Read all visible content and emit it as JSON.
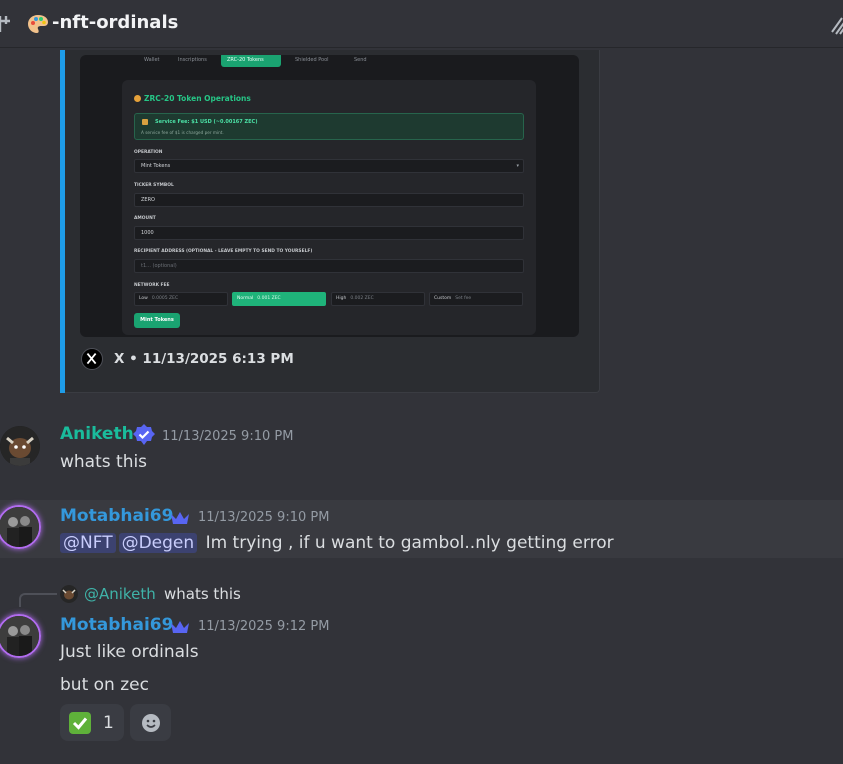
{
  "channel": {
    "emoji": "palette-icon",
    "name": "-nft-ordinals"
  },
  "embed": {
    "image": {
      "tabs": [
        "Wallet",
        "Inscriptions",
        "ZRC-20 Tokens",
        "Shielded Pool",
        "Send"
      ],
      "title": "ZRC-20 Token Operations",
      "fee_notice_title": "Service Fee: $1 USD (~0.00167 ZEC)",
      "fee_notice_sub": "A service fee of $1 is charged per mint.",
      "operation_label": "OPERATION",
      "operation_value": "Mint Tokens",
      "ticker_label": "TICKER SYMBOL",
      "ticker_value": "ZERO",
      "amount_label": "AMOUNT",
      "amount_value": "1000",
      "recipient_label": "RECIPIENT ADDRESS (OPTIONAL - LEAVE EMPTY TO SEND TO YOURSELF)",
      "recipient_placeholder": "t1... (optional)",
      "network_fee_label": "NETWORK FEE",
      "fee_options": [
        {
          "name": "Low",
          "value": "0.0005 ZEC"
        },
        {
          "name": "Normal",
          "value": "0.001 ZEC"
        },
        {
          "name": "High",
          "value": "0.002 ZEC"
        },
        {
          "name": "Custom",
          "value": "Set fee"
        }
      ],
      "button_label": "Mint Tokens"
    },
    "footer": "X • 11/13/2025 6:13 PM"
  },
  "messages": [
    {
      "username": "Aniketh",
      "username_color": "#1abc9c",
      "timestamp": "11/13/2025 9:10 PM",
      "text": "whats this"
    },
    {
      "username": "Motabhai69",
      "username_color": "#3498db",
      "timestamp": "11/13/2025 9:10 PM",
      "mentions": [
        "@NFT",
        "@Degen"
      ],
      "text": "Im trying , if u want to gambol..nly getting error"
    },
    {
      "reply_to_name": "@Aniketh",
      "reply_to_text": "whats this",
      "username": "Motabhai69",
      "username_color": "#3498db",
      "timestamp": "11/13/2025 9:12 PM",
      "lines": [
        "Just like ordinals",
        "but on zec"
      ],
      "reaction": {
        "emoji": "check-mark-icon",
        "count": "1"
      }
    }
  ]
}
